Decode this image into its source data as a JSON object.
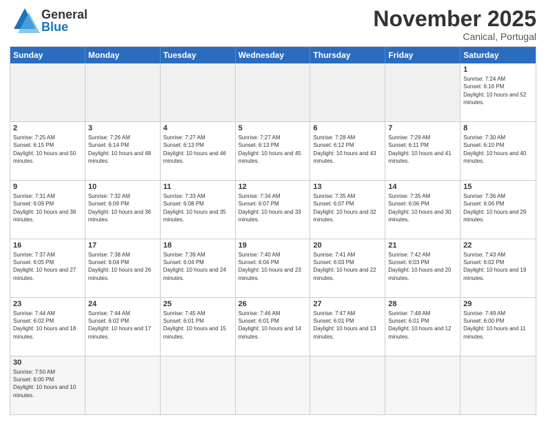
{
  "header": {
    "logo_general": "General",
    "logo_blue": "Blue",
    "month_title": "November 2025",
    "location": "Canical, Portugal"
  },
  "day_headers": [
    "Sunday",
    "Monday",
    "Tuesday",
    "Wednesday",
    "Thursday",
    "Friday",
    "Saturday"
  ],
  "weeks": [
    [
      {
        "day": "",
        "sunrise": "",
        "sunset": "",
        "daylight": ""
      },
      {
        "day": "",
        "sunrise": "",
        "sunset": "",
        "daylight": ""
      },
      {
        "day": "",
        "sunrise": "",
        "sunset": "",
        "daylight": ""
      },
      {
        "day": "",
        "sunrise": "",
        "sunset": "",
        "daylight": ""
      },
      {
        "day": "",
        "sunrise": "",
        "sunset": "",
        "daylight": ""
      },
      {
        "day": "",
        "sunrise": "",
        "sunset": "",
        "daylight": ""
      },
      {
        "day": "1",
        "sunrise": "Sunrise: 7:24 AM",
        "sunset": "Sunset: 6:16 PM",
        "daylight": "Daylight: 10 hours and 52 minutes."
      }
    ],
    [
      {
        "day": "2",
        "sunrise": "Sunrise: 7:25 AM",
        "sunset": "Sunset: 6:15 PM",
        "daylight": "Daylight: 10 hours and 50 minutes."
      },
      {
        "day": "3",
        "sunrise": "Sunrise: 7:26 AM",
        "sunset": "Sunset: 6:14 PM",
        "daylight": "Daylight: 10 hours and 48 minutes."
      },
      {
        "day": "4",
        "sunrise": "Sunrise: 7:27 AM",
        "sunset": "Sunset: 6:13 PM",
        "daylight": "Daylight: 10 hours and 46 minutes."
      },
      {
        "day": "5",
        "sunrise": "Sunrise: 7:27 AM",
        "sunset": "Sunset: 6:13 PM",
        "daylight": "Daylight: 10 hours and 45 minutes."
      },
      {
        "day": "6",
        "sunrise": "Sunrise: 7:28 AM",
        "sunset": "Sunset: 6:12 PM",
        "daylight": "Daylight: 10 hours and 43 minutes."
      },
      {
        "day": "7",
        "sunrise": "Sunrise: 7:29 AM",
        "sunset": "Sunset: 6:11 PM",
        "daylight": "Daylight: 10 hours and 41 minutes."
      },
      {
        "day": "8",
        "sunrise": "Sunrise: 7:30 AM",
        "sunset": "Sunset: 6:10 PM",
        "daylight": "Daylight: 10 hours and 40 minutes."
      }
    ],
    [
      {
        "day": "9",
        "sunrise": "Sunrise: 7:31 AM",
        "sunset": "Sunset: 6:09 PM",
        "daylight": "Daylight: 10 hours and 38 minutes."
      },
      {
        "day": "10",
        "sunrise": "Sunrise: 7:32 AM",
        "sunset": "Sunset: 6:09 PM",
        "daylight": "Daylight: 10 hours and 36 minutes."
      },
      {
        "day": "11",
        "sunrise": "Sunrise: 7:33 AM",
        "sunset": "Sunset: 6:08 PM",
        "daylight": "Daylight: 10 hours and 35 minutes."
      },
      {
        "day": "12",
        "sunrise": "Sunrise: 7:34 AM",
        "sunset": "Sunset: 6:07 PM",
        "daylight": "Daylight: 10 hours and 33 minutes."
      },
      {
        "day": "13",
        "sunrise": "Sunrise: 7:35 AM",
        "sunset": "Sunset: 6:07 PM",
        "daylight": "Daylight: 10 hours and 32 minutes."
      },
      {
        "day": "14",
        "sunrise": "Sunrise: 7:35 AM",
        "sunset": "Sunset: 6:06 PM",
        "daylight": "Daylight: 10 hours and 30 minutes."
      },
      {
        "day": "15",
        "sunrise": "Sunrise: 7:36 AM",
        "sunset": "Sunset: 6:06 PM",
        "daylight": "Daylight: 10 hours and 29 minutes."
      }
    ],
    [
      {
        "day": "16",
        "sunrise": "Sunrise: 7:37 AM",
        "sunset": "Sunset: 6:05 PM",
        "daylight": "Daylight: 10 hours and 27 minutes."
      },
      {
        "day": "17",
        "sunrise": "Sunrise: 7:38 AM",
        "sunset": "Sunset: 6:04 PM",
        "daylight": "Daylight: 10 hours and 26 minutes."
      },
      {
        "day": "18",
        "sunrise": "Sunrise: 7:39 AM",
        "sunset": "Sunset: 6:04 PM",
        "daylight": "Daylight: 10 hours and 24 minutes."
      },
      {
        "day": "19",
        "sunrise": "Sunrise: 7:40 AM",
        "sunset": "Sunset: 6:04 PM",
        "daylight": "Daylight: 10 hours and 23 minutes."
      },
      {
        "day": "20",
        "sunrise": "Sunrise: 7:41 AM",
        "sunset": "Sunset: 6:03 PM",
        "daylight": "Daylight: 10 hours and 22 minutes."
      },
      {
        "day": "21",
        "sunrise": "Sunrise: 7:42 AM",
        "sunset": "Sunset: 6:03 PM",
        "daylight": "Daylight: 10 hours and 20 minutes."
      },
      {
        "day": "22",
        "sunrise": "Sunrise: 7:43 AM",
        "sunset": "Sunset: 6:02 PM",
        "daylight": "Daylight: 10 hours and 19 minutes."
      }
    ],
    [
      {
        "day": "23",
        "sunrise": "Sunrise: 7:44 AM",
        "sunset": "Sunset: 6:02 PM",
        "daylight": "Daylight: 10 hours and 18 minutes."
      },
      {
        "day": "24",
        "sunrise": "Sunrise: 7:44 AM",
        "sunset": "Sunset: 6:02 PM",
        "daylight": "Daylight: 10 hours and 17 minutes."
      },
      {
        "day": "25",
        "sunrise": "Sunrise: 7:45 AM",
        "sunset": "Sunset: 6:01 PM",
        "daylight": "Daylight: 10 hours and 15 minutes."
      },
      {
        "day": "26",
        "sunrise": "Sunrise: 7:46 AM",
        "sunset": "Sunset: 6:01 PM",
        "daylight": "Daylight: 10 hours and 14 minutes."
      },
      {
        "day": "27",
        "sunrise": "Sunrise: 7:47 AM",
        "sunset": "Sunset: 6:01 PM",
        "daylight": "Daylight: 10 hours and 13 minutes."
      },
      {
        "day": "28",
        "sunrise": "Sunrise: 7:48 AM",
        "sunset": "Sunset: 6:01 PM",
        "daylight": "Daylight: 10 hours and 12 minutes."
      },
      {
        "day": "29",
        "sunrise": "Sunrise: 7:49 AM",
        "sunset": "Sunset: 6:00 PM",
        "daylight": "Daylight: 10 hours and 11 minutes."
      }
    ],
    [
      {
        "day": "30",
        "sunrise": "Sunrise: 7:50 AM",
        "sunset": "Sunset: 6:00 PM",
        "daylight": "Daylight: 10 hours and 10 minutes."
      },
      {
        "day": "",
        "sunrise": "",
        "sunset": "",
        "daylight": ""
      },
      {
        "day": "",
        "sunrise": "",
        "sunset": "",
        "daylight": ""
      },
      {
        "day": "",
        "sunrise": "",
        "sunset": "",
        "daylight": ""
      },
      {
        "day": "",
        "sunrise": "",
        "sunset": "",
        "daylight": ""
      },
      {
        "day": "",
        "sunrise": "",
        "sunset": "",
        "daylight": ""
      },
      {
        "day": "",
        "sunrise": "",
        "sunset": "",
        "daylight": ""
      }
    ]
  ]
}
